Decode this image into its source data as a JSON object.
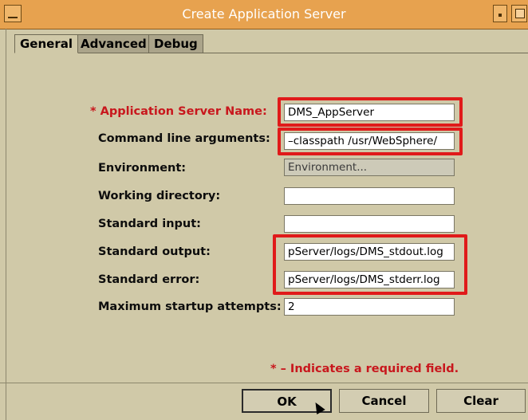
{
  "window": {
    "title": "Create Application Server"
  },
  "tabs": [
    {
      "label": "General",
      "active": true
    },
    {
      "label": "Advanced",
      "active": false
    },
    {
      "label": "Debug",
      "active": false
    }
  ],
  "form": {
    "app_server_name": {
      "label": "* Application Server Name:",
      "value": "DMS_AppServer",
      "required": true
    },
    "command_line_args": {
      "label": "Command line arguments:",
      "value": "–classpath /usr/WebSphere/"
    },
    "environment": {
      "label": "Environment:",
      "button_label": "Environment..."
    },
    "working_directory": {
      "label": "Working directory:",
      "value": ""
    },
    "standard_input": {
      "label": "Standard input:",
      "value": ""
    },
    "standard_output": {
      "label": "Standard output:",
      "value": "pServer/logs/DMS_stdout.log"
    },
    "standard_error": {
      "label": "Standard error:",
      "value": "pServer/logs/DMS_stderr.log"
    },
    "max_startup_attempts": {
      "label": "Maximum startup attempts:",
      "value": "2"
    }
  },
  "required_note": "* – Indicates a required field.",
  "buttons": {
    "ok": "OK",
    "cancel": "Cancel",
    "clear": "Clear"
  },
  "colors": {
    "titlebar": "#e7a24f",
    "dialog_bg": "#d0c9a8",
    "required_text": "#c8171d",
    "highlight": "#e01a1a"
  },
  "icons": [
    "window-menu-icon",
    "minimize-icon",
    "maximize-icon",
    "mouse-pointer-icon"
  ]
}
